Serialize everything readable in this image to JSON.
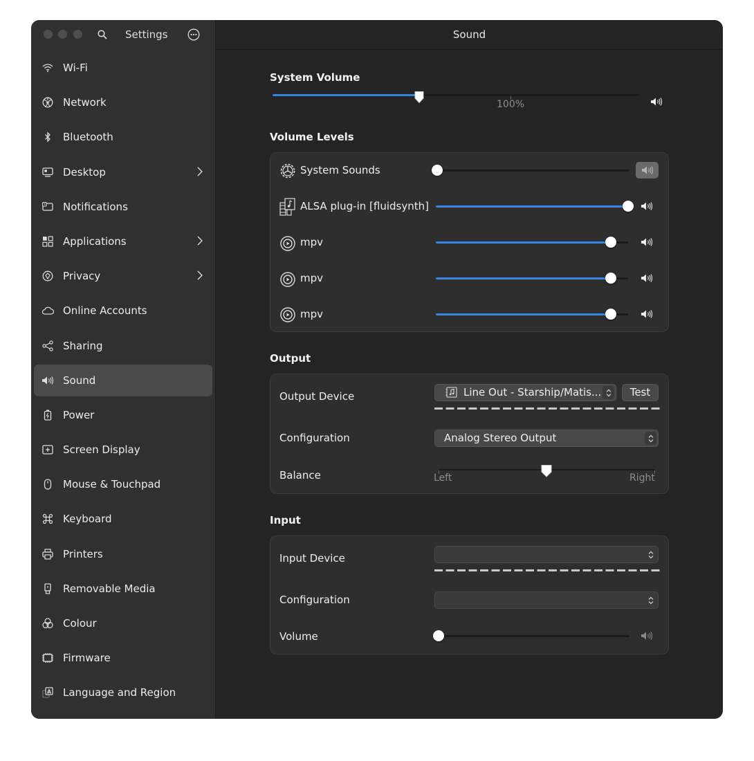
{
  "window": {
    "sidebar_title": "Settings",
    "page_title": "Sound"
  },
  "sidebar": {
    "items": [
      {
        "label": "Wi-Fi",
        "icon": "wifi-icon"
      },
      {
        "label": "Network",
        "icon": "network-icon"
      },
      {
        "label": "Bluetooth",
        "icon": "bluetooth-icon"
      },
      {
        "label": "Desktop",
        "icon": "desktop-icon",
        "chevron": true
      },
      {
        "label": "Notifications",
        "icon": "notifications-icon"
      },
      {
        "label": "Applications",
        "icon": "applications-icon",
        "chevron": true
      },
      {
        "label": "Privacy",
        "icon": "privacy-icon",
        "chevron": true
      },
      {
        "label": "Online Accounts",
        "icon": "cloud-icon"
      },
      {
        "label": "Sharing",
        "icon": "sharing-icon"
      },
      {
        "label": "Sound",
        "icon": "speaker-icon",
        "active": true
      },
      {
        "label": "Power",
        "icon": "power-icon"
      },
      {
        "label": "Screen Display",
        "icon": "display-icon"
      },
      {
        "label": "Mouse & Touchpad",
        "icon": "mouse-icon"
      },
      {
        "label": "Keyboard",
        "icon": "keyboard-icon"
      },
      {
        "label": "Printers",
        "icon": "printer-icon"
      },
      {
        "label": "Removable Media",
        "icon": "removable-media-icon"
      },
      {
        "label": "Colour",
        "icon": "colour-icon"
      },
      {
        "label": "Firmware",
        "icon": "firmware-icon"
      },
      {
        "label": "Language and Region",
        "icon": "language-icon"
      }
    ]
  },
  "system_volume": {
    "title": "System Volume",
    "level": 0.4,
    "mark_label": "100%"
  },
  "volume_levels": {
    "title": "Volume Levels",
    "streams": [
      {
        "name": "System Sounds",
        "icon": "gear-icon",
        "level": 0.0,
        "muted": true
      },
      {
        "name": "ALSA plug-in [fluidsynth]",
        "icon": "multimedia-icon",
        "level": 1.0
      },
      {
        "name": "mpv",
        "icon": "mpv-icon",
        "level": 0.91
      },
      {
        "name": "mpv",
        "icon": "mpv-icon",
        "level": 0.91
      },
      {
        "name": "mpv",
        "icon": "mpv-icon",
        "level": 0.91
      }
    ]
  },
  "output": {
    "title": "Output",
    "device_label": "Output Device",
    "device_value": "Line Out - Starship/Matis...",
    "test_label": "Test",
    "config_label": "Configuration",
    "config_value": "Analog Stereo Output",
    "balance_label": "Balance",
    "balance_value": 0.5,
    "left_label": "Left",
    "right_label": "Right"
  },
  "input": {
    "title": "Input",
    "device_label": "Input Device",
    "device_value": "",
    "config_label": "Configuration",
    "config_value": "",
    "volume_label": "Volume",
    "volume_level": 0.0
  },
  "colors": {
    "accent": "#3584e4",
    "window_bg": "#242424",
    "sidebar_bg": "#303030"
  }
}
